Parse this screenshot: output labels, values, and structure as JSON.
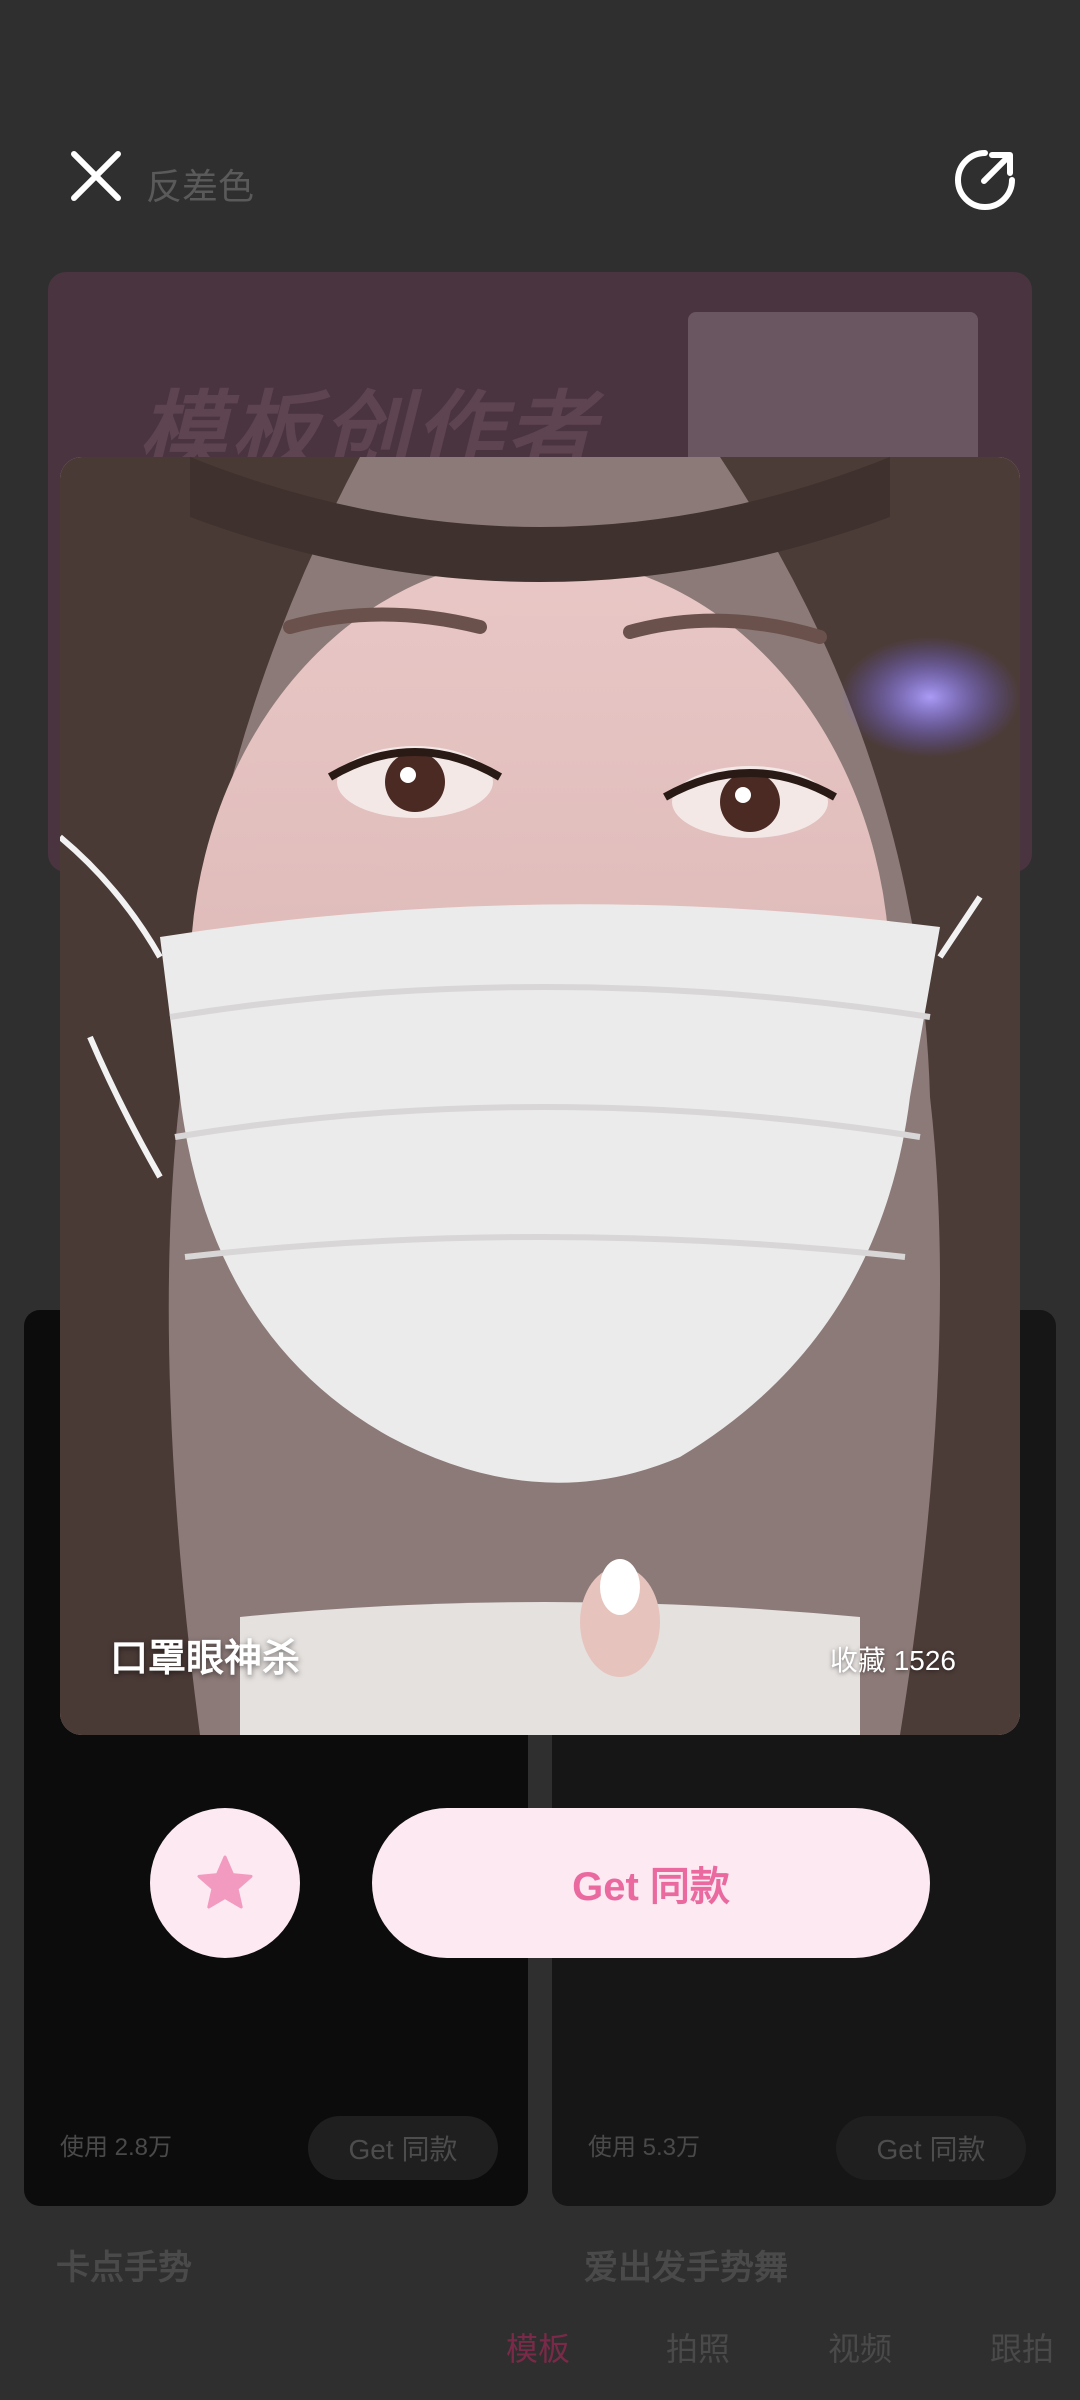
{
  "topbar": {
    "title": "反差色",
    "close_icon": "close-icon",
    "share_icon": "share-icon"
  },
  "banner": {
    "text": "模板创作者"
  },
  "cards": [
    {
      "use_text": "使用 2.8万",
      "get_label": "Get 同款",
      "title": "卡点手势"
    },
    {
      "use_text": "使用 5.3万",
      "get_label": "Get 同款",
      "title": "爱出发手势舞"
    }
  ],
  "tabs": [
    {
      "label": "模板",
      "active": true
    },
    {
      "label": "拍照",
      "active": false
    },
    {
      "label": "视频",
      "active": false
    },
    {
      "label": "跟拍",
      "active": false
    }
  ],
  "preview": {
    "caption": "口罩眼神杀",
    "favorites": "收藏 1526"
  },
  "actions": {
    "favorite_icon": "star-icon",
    "get_label": "Get 同款"
  },
  "colors": {
    "accent": "#ea6aa0",
    "button_bg": "#fce9f2",
    "overlay": "#2b2b2b"
  }
}
